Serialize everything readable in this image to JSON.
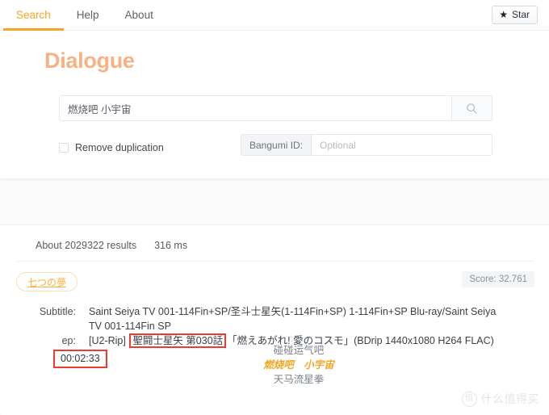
{
  "nav": {
    "tabs": [
      {
        "label": "Search",
        "active": true
      },
      {
        "label": "Help",
        "active": false
      },
      {
        "label": "About",
        "active": false
      }
    ],
    "star_button": {
      "label": "Star",
      "icon": "star-icon"
    },
    "active_accent": "#f5a623"
  },
  "header": {
    "title": "Dialogue",
    "title_color": "#f7b183"
  },
  "search": {
    "value": "燃烧吧 小宇宙",
    "placeholder": "",
    "button_icon": "search-icon"
  },
  "options": {
    "remove_duplication": {
      "label": "Remove duplication",
      "checked": false
    },
    "bangumi": {
      "addon_label": "Bangumi ID:",
      "placeholder": "Optional",
      "value": ""
    }
  },
  "results": {
    "count_text": "About 2029322 results",
    "time_text": "316 ms",
    "items": [
      {
        "tag": "七つの夢",
        "score": "Score: 32.761",
        "fields": [
          {
            "label": "Subtitle:",
            "value": "Saint Seiya TV 001-114Fin+SP/圣斗士星矢(1-114Fin+SP) 1-114Fin+SP Blu-ray/Saint Seiya TV 001-114Fin SP"
          }
        ],
        "ep": {
          "label": "ep:",
          "prefix": "[U2-Rip] ",
          "highlight": "聖闘士星矢 第030話",
          "suffix": "「燃えあがれ! 愛のコスモ」(BDrip 1440x1080 H264 FLAC)"
        },
        "timestamp": "00:02:33",
        "dialogue": [
          {
            "text": "碰碰运气吧",
            "match": false
          },
          {
            "text": "燃烧吧　小宇宙",
            "match": true
          },
          {
            "text": "天马流星拳",
            "match": false
          }
        ]
      }
    ],
    "highlight_color": "#ef3b2d"
  },
  "watermark": {
    "badge": "值",
    "text": "什么值得买"
  }
}
